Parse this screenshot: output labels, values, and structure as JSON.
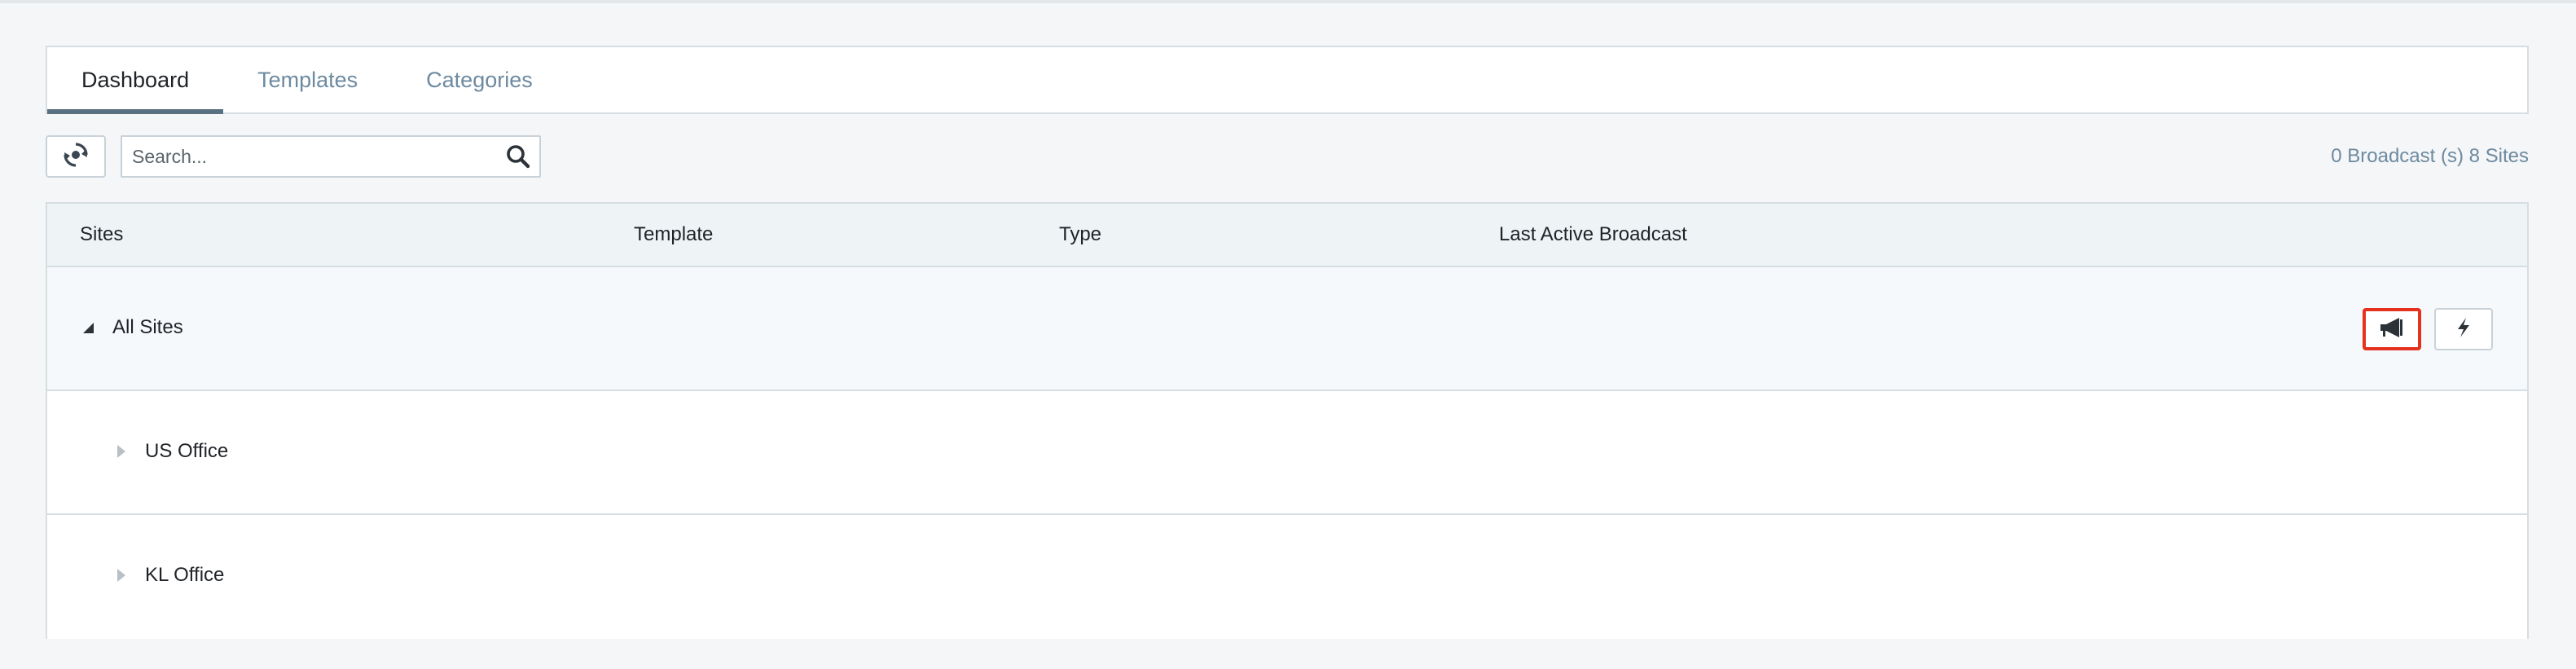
{
  "tabs": [
    {
      "label": "Dashboard",
      "active": true
    },
    {
      "label": "Templates",
      "active": false
    },
    {
      "label": "Categories",
      "active": false
    }
  ],
  "toolbar": {
    "refresh_icon": "refresh-icon",
    "search_placeholder": "Search...",
    "search_value": "",
    "search_icon": "search-icon",
    "summary": "0 Broadcast (s) 8 Sites"
  },
  "table": {
    "columns": [
      "Sites",
      "Template",
      "Type",
      "Last Active Broadcast"
    ],
    "rows": [
      {
        "label": "All Sites",
        "expanded": true,
        "level": 0
      },
      {
        "label": "US Office",
        "expanded": false,
        "level": 1
      },
      {
        "label": "KL Office",
        "expanded": false,
        "level": 1
      }
    ],
    "actions": {
      "broadcast_icon": "megaphone-icon",
      "quick_icon": "lightning-icon",
      "highlight_color": "#e5321f"
    }
  },
  "colors": {
    "tab_inactive": "#6d8aa0",
    "tab_indicator": "#5a7182",
    "border": "#d6dee3",
    "header_bg": "#eef3f6"
  }
}
